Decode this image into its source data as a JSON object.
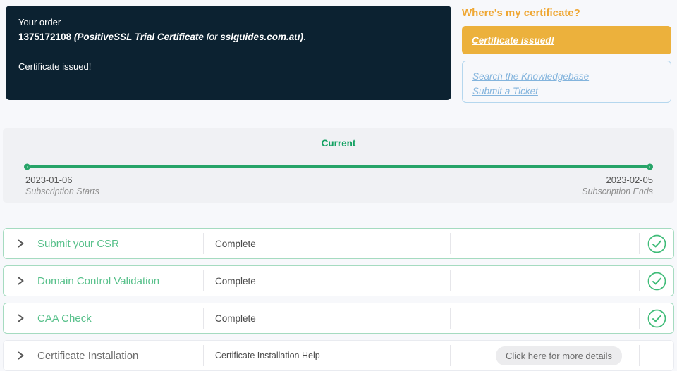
{
  "order_box": {
    "label": "Your order",
    "order_id": "1375172108",
    "product": "(PositiveSSL Trial Certificate",
    "for_word": "for",
    "domain": "sslguides.com.au)",
    "terminator": ".",
    "status": "Certificate issued!"
  },
  "help_panel": {
    "title": "Where's my certificate?",
    "issued_button": "Certificate issued!",
    "links": {
      "knowledgebase": "Search the Knowledgebase",
      "ticket": "Submit a Ticket"
    }
  },
  "timeline": {
    "current_label": "Current",
    "start": {
      "date": "2023-01-06",
      "label": "Subscription Starts"
    },
    "end": {
      "date": "2023-02-05",
      "label": "Subscription Ends"
    }
  },
  "steps": [
    {
      "title": "Submit your CSR",
      "status": "Complete",
      "complete": true
    },
    {
      "title": "Domain Control Validation",
      "status": "Complete",
      "complete": true
    },
    {
      "title": "CAA Check",
      "status": "Complete",
      "complete": true
    },
    {
      "title": "Certificate Installation",
      "status": "Certificate Installation Help",
      "action_label": "Click here for more details",
      "complete": false
    }
  ],
  "icons": {
    "chevron": "chevron-right-icon",
    "check": "check-circle-icon"
  },
  "colors": {
    "dark_navy": "#0c2231",
    "heading_orange": "#efa733",
    "button_yellow": "#ecb13c",
    "link_blue": "#83b4dd",
    "timeline_green": "#27a468",
    "current_green": "#13a162",
    "title_green": "#57c08a",
    "check_green": "#3fbc78"
  }
}
